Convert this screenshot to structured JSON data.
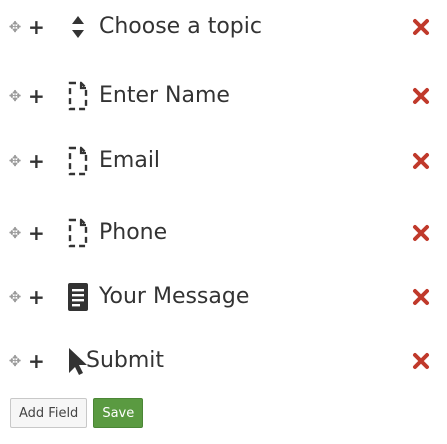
{
  "colors": {
    "delete": "#c0392b",
    "save_bg": "#5a9a41",
    "text": "#333333"
  },
  "fields": [
    {
      "label": "Choose a topic",
      "icon": "sort-icon"
    },
    {
      "label": "Enter Name",
      "icon": "file-outline-icon"
    },
    {
      "label": "Email",
      "icon": "file-outline-icon"
    },
    {
      "label": "Phone",
      "icon": "file-outline-icon"
    },
    {
      "label": "Your Message",
      "icon": "text-document-icon"
    },
    {
      "label": "Submit",
      "icon": "pointer-icon"
    }
  ],
  "actions": {
    "add_field_label": "Add Field",
    "save_label": "Save"
  }
}
